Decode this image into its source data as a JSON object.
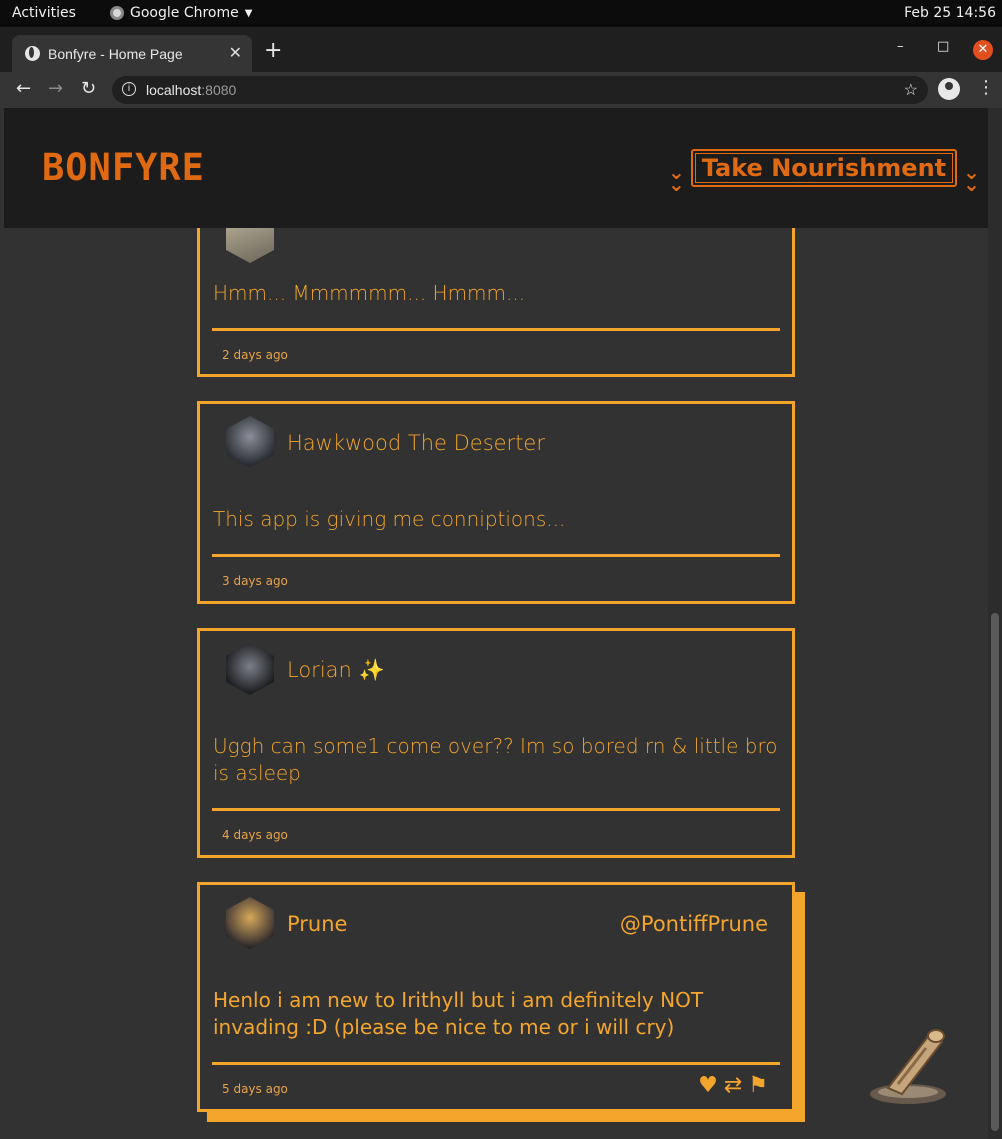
{
  "system": {
    "activities": "Activities",
    "app_name": "Google Chrome",
    "clock": "Feb 25  14:56"
  },
  "browser": {
    "tab_title": "Bonfyre - Home Page",
    "url_host": "localhost",
    "url_port": ":8080"
  },
  "site": {
    "brand": "BONFYRE",
    "nav_button": "Take Nourishment"
  },
  "posts": [
    {
      "name": "",
      "handle": "",
      "body": "Hmm... Mmmmmm... Hmmm...",
      "time": "2 days ago"
    },
    {
      "name": "Hawkwood The Deserter",
      "handle": "",
      "body": "This app is giving me conniptions...",
      "time": "3 days ago"
    },
    {
      "name": "Lorian ✨",
      "handle": "",
      "body": "Uggh can some1 come over?? Im so bored rn & little bro is asleep",
      "time": "4 days ago"
    },
    {
      "name": "Prune",
      "handle": "@PontiffPrune",
      "body": "Henlo i am new to Irithyll but i am definitely NOT invading :D (please be nice to me or i will cry)",
      "time": "5 days ago"
    }
  ],
  "colors": {
    "accent": "#f4a52c",
    "brand": "#e06a12",
    "background": "#323232"
  }
}
